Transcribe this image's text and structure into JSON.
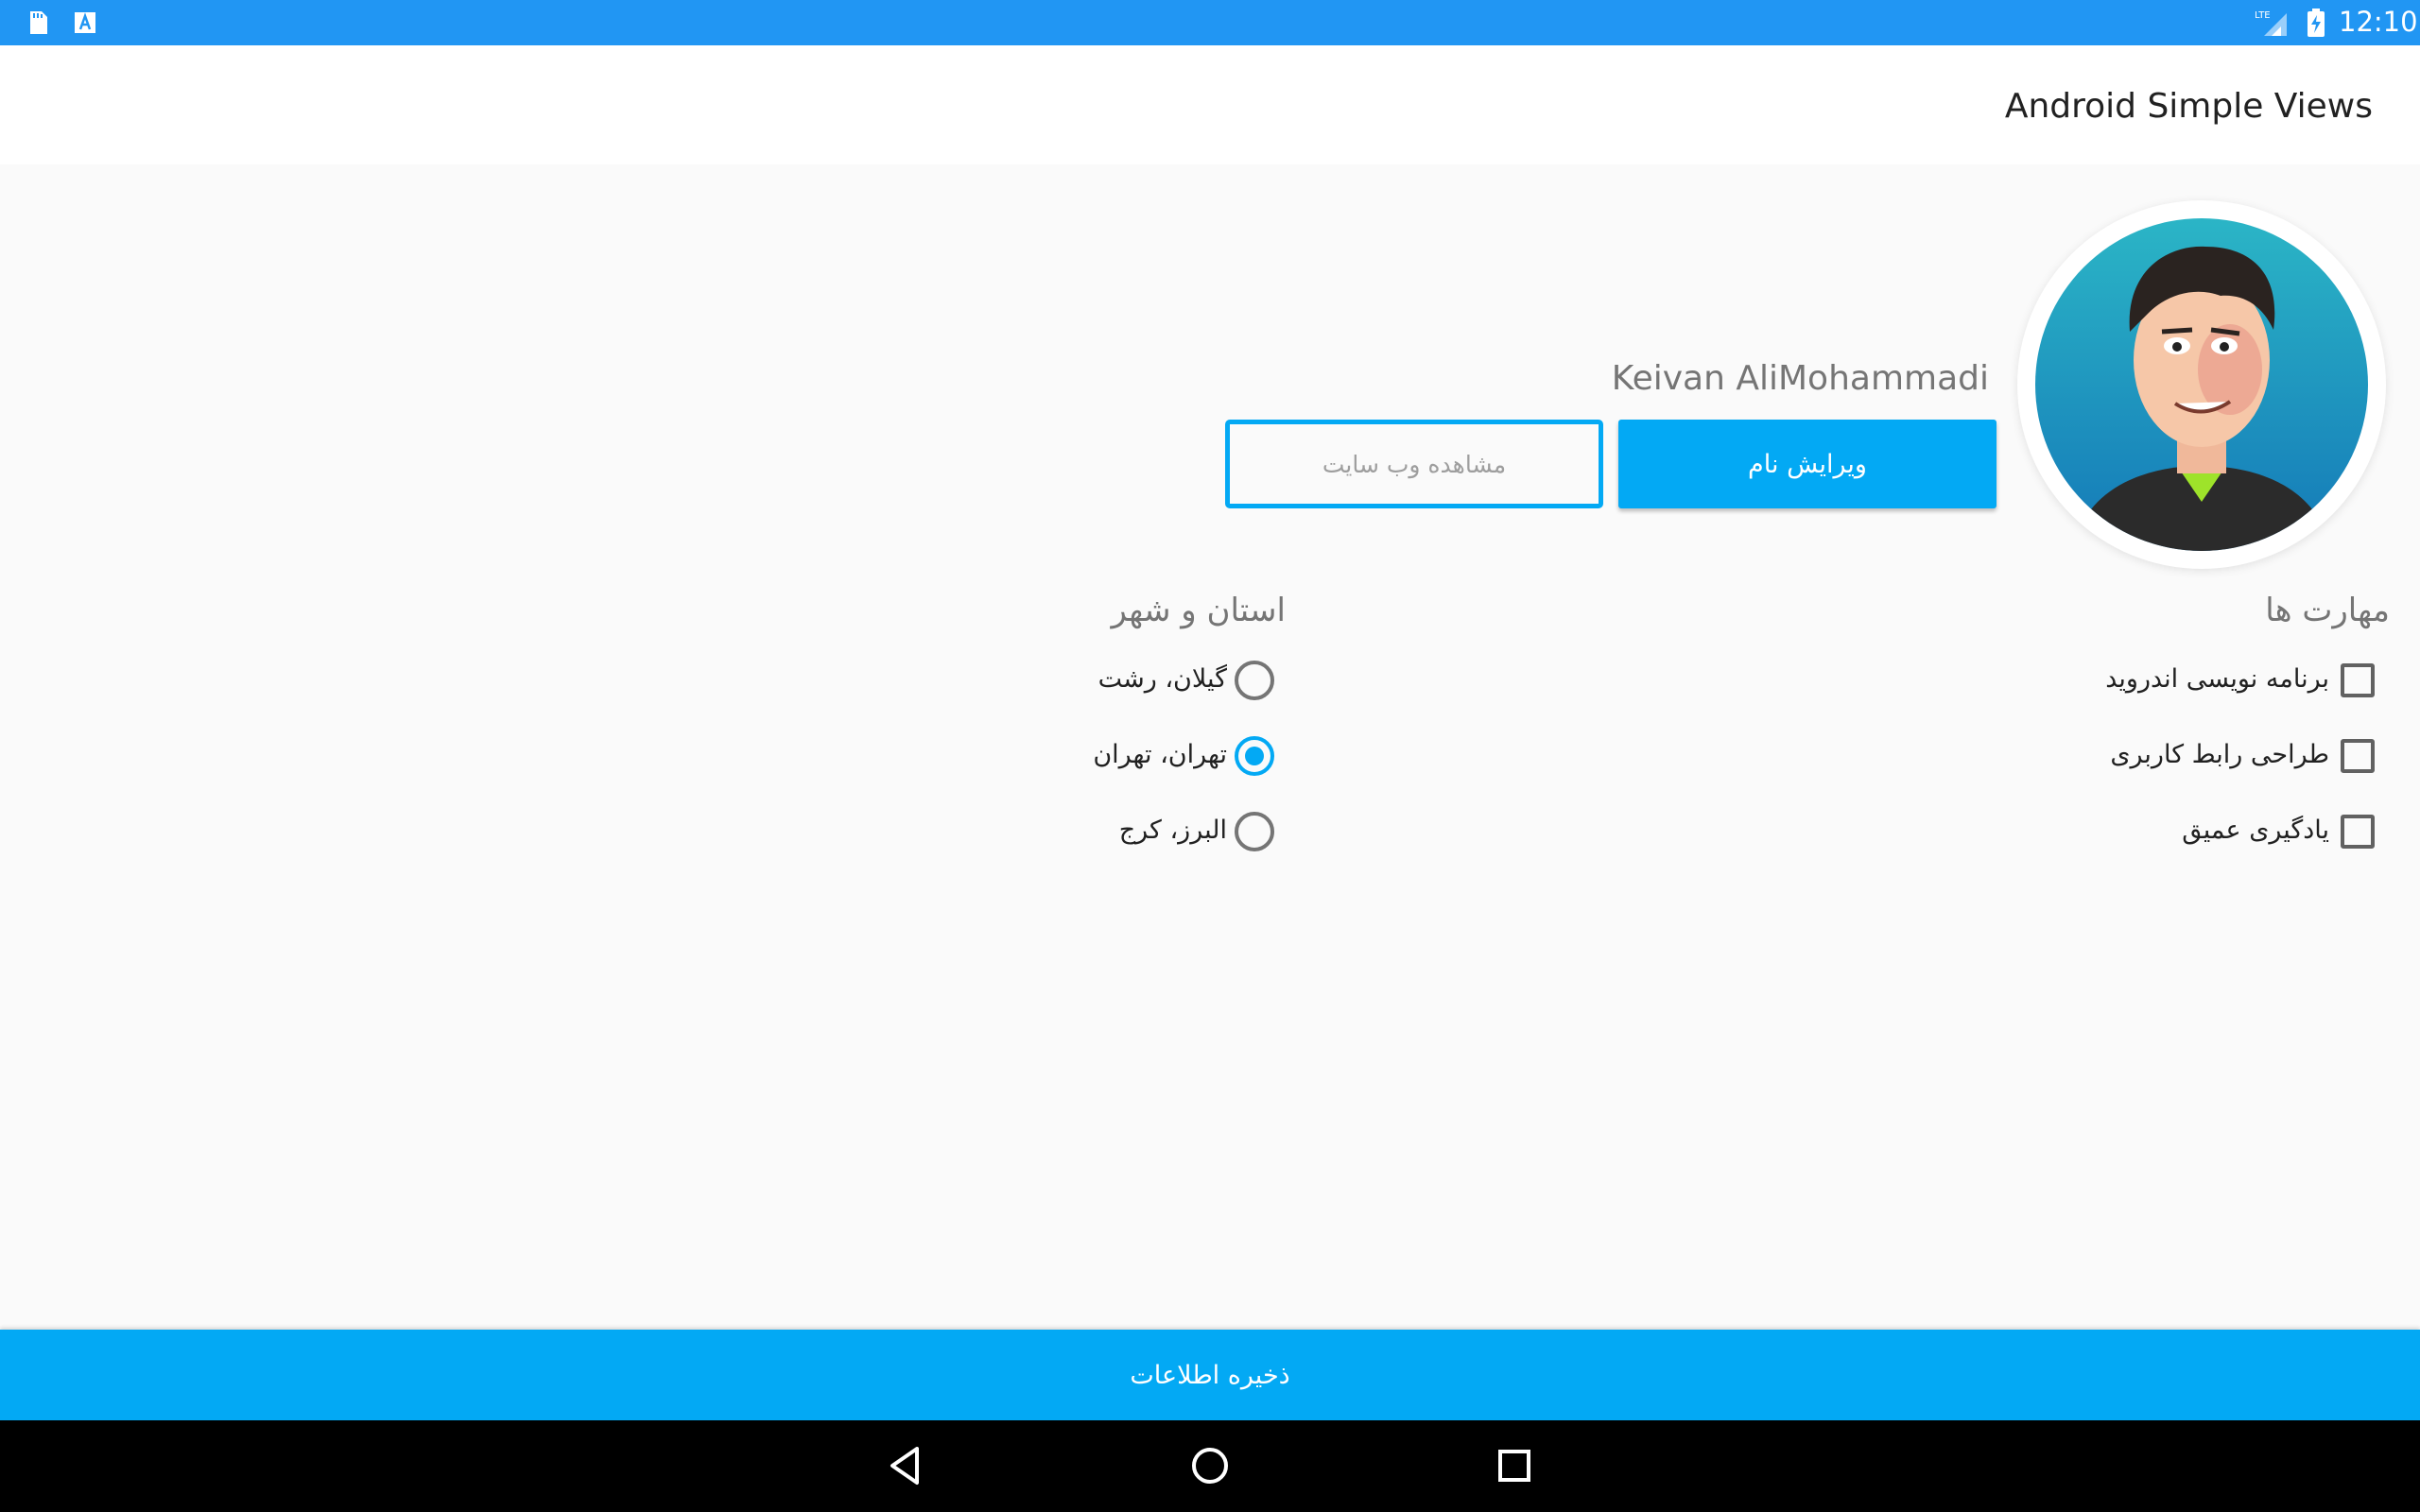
{
  "status_bar": {
    "time": "12:10",
    "left_icons": [
      "sd-card-icon",
      "text-a-icon"
    ],
    "right_icons": [
      "lte-signal-icon",
      "battery-charging-icon"
    ],
    "color": "#2196f3"
  },
  "toolbar": {
    "title": "Android Simple Views"
  },
  "profile": {
    "avatar_icon": "avatar-cartoon-portrait",
    "name": "Keivan AliMohammadi",
    "edit_name_label": "ویرایش نام",
    "view_website_label": "مشاهده وب سایت"
  },
  "skills": {
    "title": "مهارت ها",
    "items": [
      {
        "label": "برنامه نویسی اندروید",
        "checked": false
      },
      {
        "label": "طراحی رابط کاربری",
        "checked": false
      },
      {
        "label": "یادگیری عمیق",
        "checked": false
      }
    ]
  },
  "province": {
    "title": "استان و شهر",
    "options": [
      {
        "label": "گیلان، رشت",
        "selected": false
      },
      {
        "label": "تهران، تهران",
        "selected": true
      },
      {
        "label": "البرز، کرج",
        "selected": false
      }
    ]
  },
  "save_label": "ذخیره اطلاعات",
  "nav_bar": {
    "icons": [
      "back-icon",
      "home-icon",
      "recents-icon"
    ]
  },
  "colors": {
    "accent": "#03a9f4",
    "status_bar": "#2196f3",
    "background": "#fafafa"
  }
}
